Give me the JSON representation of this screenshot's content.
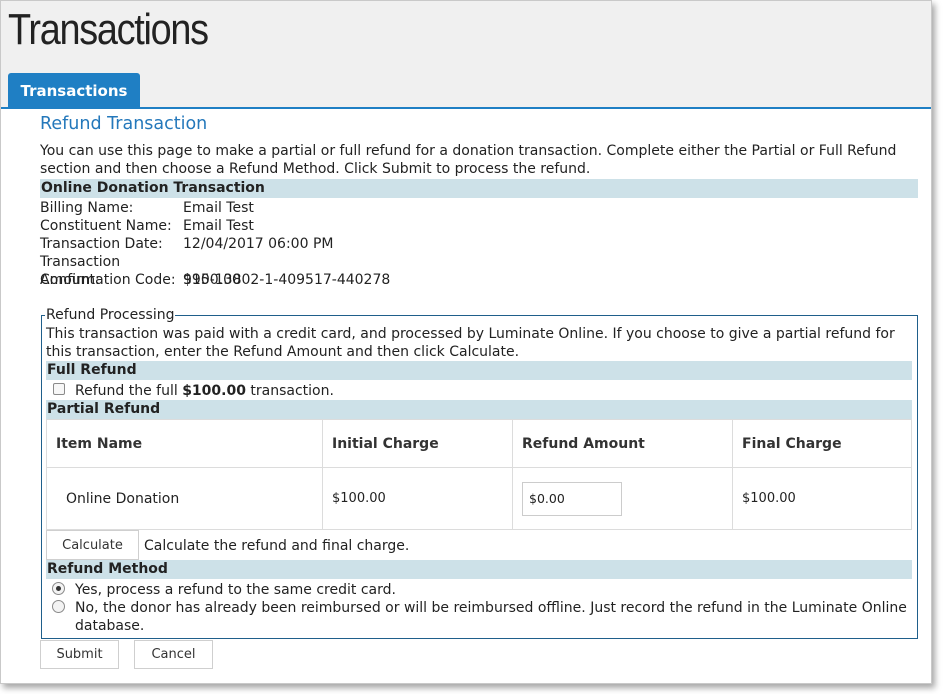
{
  "page": {
    "title": "Transactions"
  },
  "tabs": [
    {
      "label": "Transactions",
      "active": true
    }
  ],
  "refund": {
    "heading": "Refund Transaction",
    "intro": "You can use this page to make a partial or full refund for a donation transaction. Complete either the Partial or Full Refund section and then choose a Refund Method. Click Submit to process the refund."
  },
  "transaction": {
    "heading": "Online Donation Transaction",
    "fields": [
      {
        "label": "Billing Name:",
        "value": "Email Test"
      },
      {
        "label": "Constituent Name:",
        "value": "Email Test"
      },
      {
        "label": "Transaction Date:",
        "value": "12/04/2017 06:00 PM"
      },
      {
        "label": "Transaction Amount:",
        "value": "$100.00"
      },
      {
        "label": "Confirmation Code:",
        "value": "995-13802-1-409517-440278"
      }
    ]
  },
  "processing": {
    "legend": "Refund Processing",
    "description": "This transaction was paid with a credit card, and processed by Luminate Online. If you choose to give a partial refund for this transaction, enter the Refund Amount and then click Calculate.",
    "full_refund": {
      "heading": "Full Refund",
      "text_before": "Refund the full ",
      "amount": "$100.00",
      "text_after": " transaction.",
      "checked": false
    },
    "partial_refund": {
      "heading": "Partial Refund",
      "columns": [
        "Item Name",
        "Initial Charge",
        "Refund Amount",
        "Final Charge"
      ],
      "rows": [
        {
          "item_name": "Online Donation",
          "initial_charge": "$100.00",
          "refund_amount": "$0.00",
          "final_charge": "$100.00"
        }
      ],
      "calculate_label": "Calculate",
      "calculate_help": "Calculate the refund and final charge."
    },
    "refund_method": {
      "heading": "Refund Method",
      "options": [
        {
          "label": "Yes, process a refund to the same credit card.",
          "selected": true
        },
        {
          "label": "No, the donor has already been reimbursed or will be reimbursed offline. Just record the refund in the Luminate Online database.",
          "selected": false
        }
      ]
    }
  },
  "actions": {
    "submit_label": "Submit",
    "cancel_label": "Cancel"
  },
  "colors": {
    "accent": "#1f7fc4",
    "heading_blue": "#2478bb",
    "section_bar": "#cde1e8",
    "fieldset_border": "#1f5f8b"
  },
  "icons": {
    "checkbox": "checkbox-icon",
    "radio": "radio-icon"
  }
}
